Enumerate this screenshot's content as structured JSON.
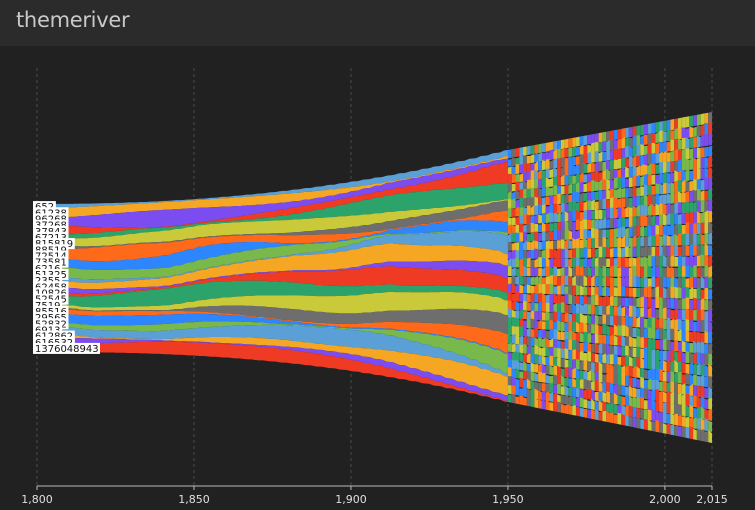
{
  "header": {
    "title": "themeriver"
  },
  "colors": {
    "background": "#212121",
    "header_bg": "#2b2b2b",
    "palette": [
      "#5aa0d6",
      "#f5a623",
      "#7b4cf0",
      "#ef3b24",
      "#2ba36b",
      "#c9c93a",
      "#6e6e6e",
      "#ff6a1a",
      "#2e86ff",
      "#79b84a"
    ]
  },
  "chart_data": {
    "type": "area",
    "subtype": "themeriver",
    "title": "",
    "xlabel": "",
    "ylabel": "",
    "xlim": [
      1800,
      2015
    ],
    "x_ticks": [
      1800,
      1850,
      1900,
      1950,
      2000,
      2015
    ],
    "x_tick_labels": [
      "1,800",
      "1,850",
      "1,900",
      "1,950",
      "2,000",
      "2,015"
    ],
    "grid": "vertical dashed",
    "series_count_before_1950": 24,
    "series_count_after_1950": "several hundred",
    "series_labels_at_1800": [
      "652",
      "61238",
      "96268",
      "37268",
      "37843",
      "67213",
      "815819",
      "88519",
      "72514",
      "73581",
      "6216",
      "51325",
      "2355",
      "62458",
      "10826",
      "52545",
      "7519",
      "85516",
      "29565",
      "52832",
      "6913",
      "612862",
      "616532",
      "1376048943"
    ]
  }
}
